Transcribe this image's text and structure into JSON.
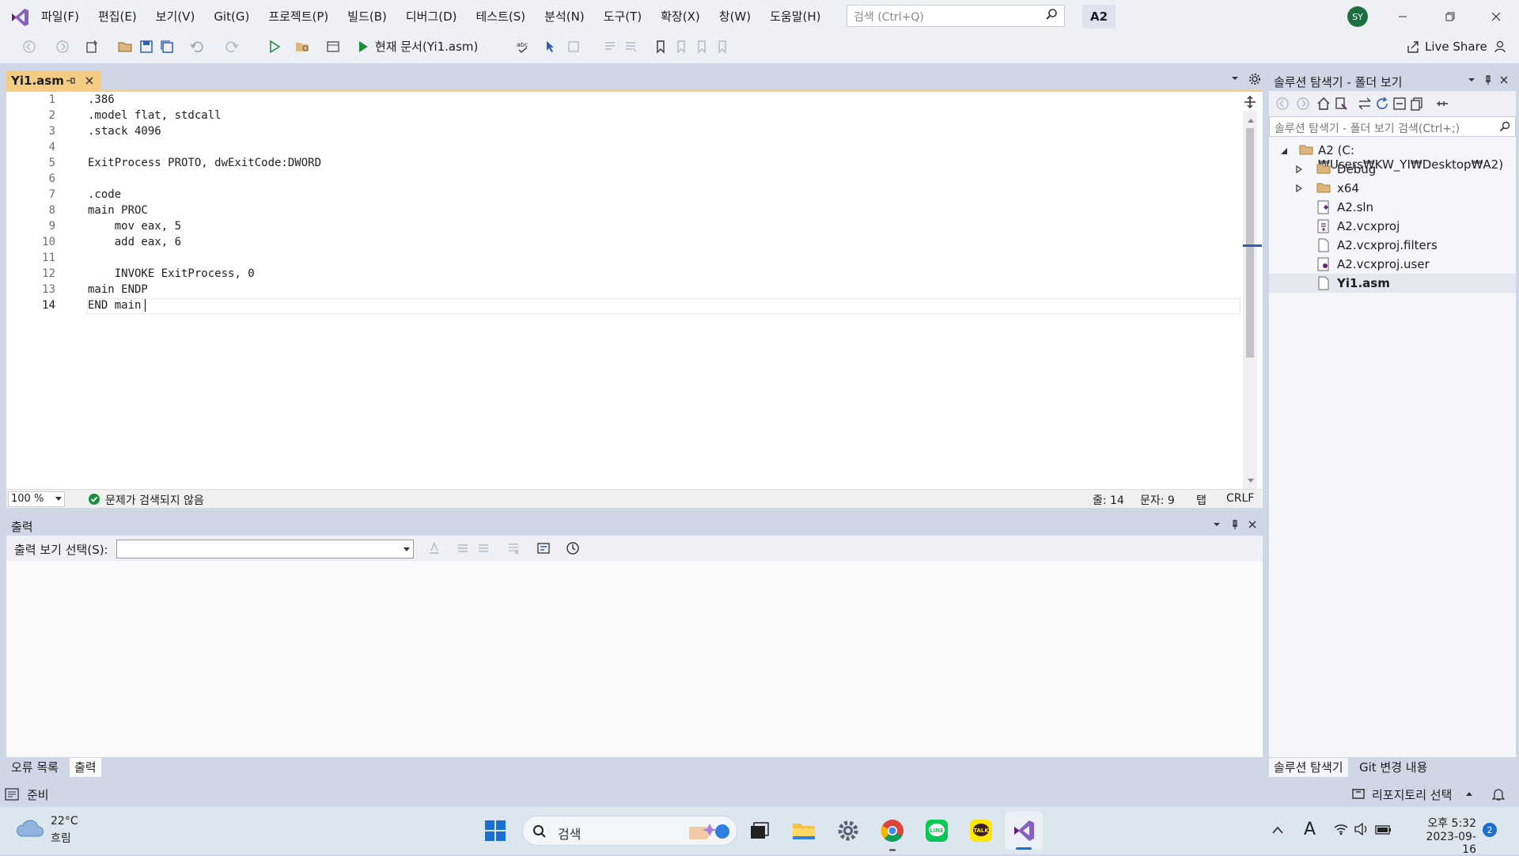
{
  "menu": [
    "파일(F)",
    "편집(E)",
    "보기(V)",
    "Git(G)",
    "프로젝트(P)",
    "빌드(B)",
    "디버그(D)",
    "테스트(S)",
    "분석(N)",
    "도구(T)",
    "확장(X)",
    "창(W)",
    "도움말(H)"
  ],
  "search": {
    "placeholder": "검색 (Ctrl+Q)"
  },
  "solution_badge": "A2",
  "user_initials": "SY",
  "toolbar": {
    "run_label": "현재 문서(Yi1.asm)",
    "live_share": "Live Share"
  },
  "editor": {
    "tab_title": "Yi1.asm",
    "lines": [
      ".386",
      ".model flat, stdcall",
      ".stack 4096",
      "",
      "ExitProcess PROTO, dwExitCode:DWORD",
      "",
      ".code",
      "main PROC",
      "    mov eax, 5",
      "    add eax, 6",
      "",
      "    INVOKE ExitProcess, 0",
      "main ENDP",
      "END main"
    ],
    "line_numbers": [
      "1",
      "2",
      "3",
      "4",
      "5",
      "6",
      "7",
      "8",
      "9",
      "10",
      "11",
      "12",
      "13",
      "14"
    ],
    "zoom": "100 %",
    "issues": "문제가 검색되지 않음",
    "line_pos": "줄: 14",
    "col_pos": "문자: 9",
    "indent": "탭",
    "eol": "CRLF"
  },
  "output": {
    "title": "출력",
    "select_label": "출력 보기 선택(S):",
    "tabs": [
      "오류 목록",
      "출력"
    ]
  },
  "solution_explorer": {
    "title": "솔루션 탐색기 - 폴더 보기",
    "search_placeholder": "솔루션 탐색기 - 폴더 보기 검색(Ctrl+;)",
    "root": "A2 (C:₩Users₩KW_YI₩Desktop₩A2)",
    "items": [
      {
        "label": "Debug",
        "type": "folder"
      },
      {
        "label": "x64",
        "type": "folder"
      },
      {
        "label": "A2.sln",
        "type": "sln"
      },
      {
        "label": "A2.vcxproj",
        "type": "vcxproj"
      },
      {
        "label": "A2.vcxproj.filters",
        "type": "file"
      },
      {
        "label": "A2.vcxproj.user",
        "type": "user"
      },
      {
        "label": "Yi1.asm",
        "type": "file"
      }
    ],
    "tabs": [
      "솔루션 탐색기",
      "Git 변경 내용"
    ]
  },
  "statusbar": {
    "ready": "준비",
    "repo": "리포지토리 선택"
  },
  "taskbar": {
    "weather_temp": "22°C",
    "weather_desc": "흐림",
    "search": "검색",
    "time": "오후 5:32",
    "date": "2023-09-16",
    "notif_count": "2",
    "ime": "A"
  },
  "colors": {
    "accent": "#f5cc84",
    "vs_purple": "#68217a",
    "status_ok": "#1e8e3e"
  }
}
